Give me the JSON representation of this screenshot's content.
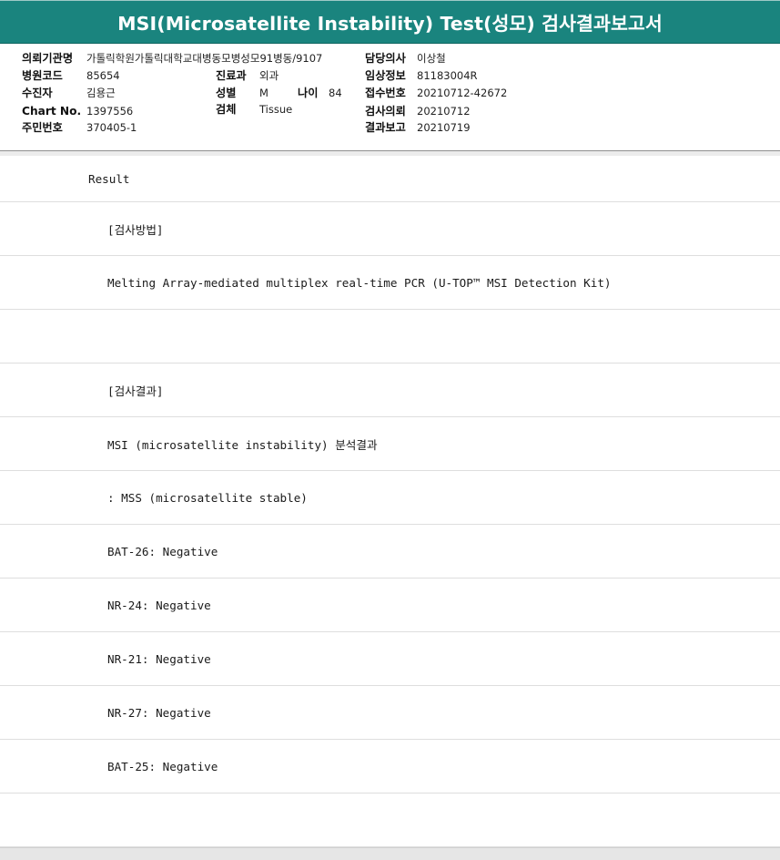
{
  "header": {
    "title": "MSI(Microsatellite Instability) Test(성모) 검사결과보고서"
  },
  "patient_info": {
    "requesting_institution_label": "의뢰기관명",
    "requesting_institution_value": "가톨릭학원가톨릭대학교대병동모병성모91병동/9107",
    "physician_label": "담당의사",
    "physician_value": "이상철",
    "hospital_code_label": "병원코드",
    "hospital_code_value": "85654",
    "department_label": "진료과",
    "department_value": "외과",
    "clinical_info_label": "임상정보",
    "clinical_info_value": "81183004R",
    "examinee_label": "수진자",
    "examinee_value": "김용근",
    "sex_label": "성별",
    "sex_value": "M",
    "age_label": "나이",
    "age_value": "84",
    "receipt_no_label": "접수번호",
    "receipt_no_value": "20210712-42672",
    "chart_no_label": "Chart No.",
    "chart_no_value": "1397556",
    "specimen_label": "검체",
    "specimen_value": "Tissue",
    "test_request_label": "검사의뢰",
    "test_request_value": "20210712",
    "resident_no_label": "주민번호",
    "resident_no_value": "370405-1",
    "result_report_label": "결과보고",
    "result_report_value": "20210719"
  },
  "report": {
    "lines": [
      "Result",
      "[검사방법]",
      "Melting Array-mediated multiplex real-time PCR (U-TOP™ MSI Detection Kit)",
      "",
      "[검사결과]",
      "MSI (microsatellite instability) 분석결과",
      ": MSS (microsatellite stable)",
      "BAT-26: Negative",
      "NR-24: Negative",
      "NR-21: Negative",
      "NR-27: Negative",
      "BAT-25: Negative",
      ""
    ]
  },
  "colors": {
    "header_bg": "#1a847e",
    "header_text": "#ffffff"
  }
}
